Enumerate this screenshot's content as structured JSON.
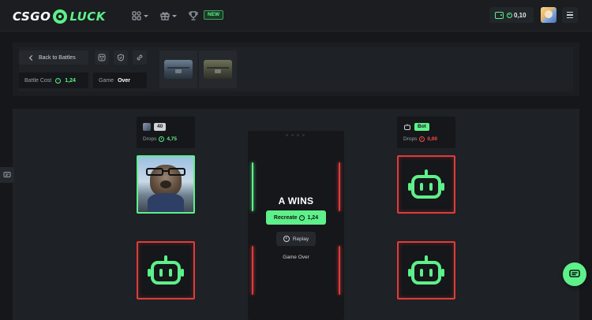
{
  "header": {
    "logo_left": "CSGO",
    "logo_right": "LUCK",
    "nav_icons": [
      "games-grid-icon",
      "gift-icon",
      "trophy-icon"
    ],
    "new_badge": "NEW",
    "balance": "0,10",
    "colors": {
      "accent": "#5ef08a",
      "danger": "#e03b3b",
      "bg": "#15171a"
    }
  },
  "battle": {
    "back_label": "Back to Battles",
    "cost_label": "Battle Cost",
    "cost_value": "1,24",
    "game_label": "Game",
    "game_value": "Over",
    "cases": [
      "blue-case",
      "olive-case"
    ]
  },
  "players": [
    {
      "level": "40",
      "drops_label": "Drops",
      "drops_value": "4,75"
    },
    {
      "tag": "Bot",
      "drops_label": "Drops",
      "drops_value": "0,00"
    }
  ],
  "result": {
    "title": "A WINS",
    "recreate_label": "Recreate",
    "recreate_value": "1,24",
    "replay_label": "Replay",
    "status": "Game Over"
  }
}
